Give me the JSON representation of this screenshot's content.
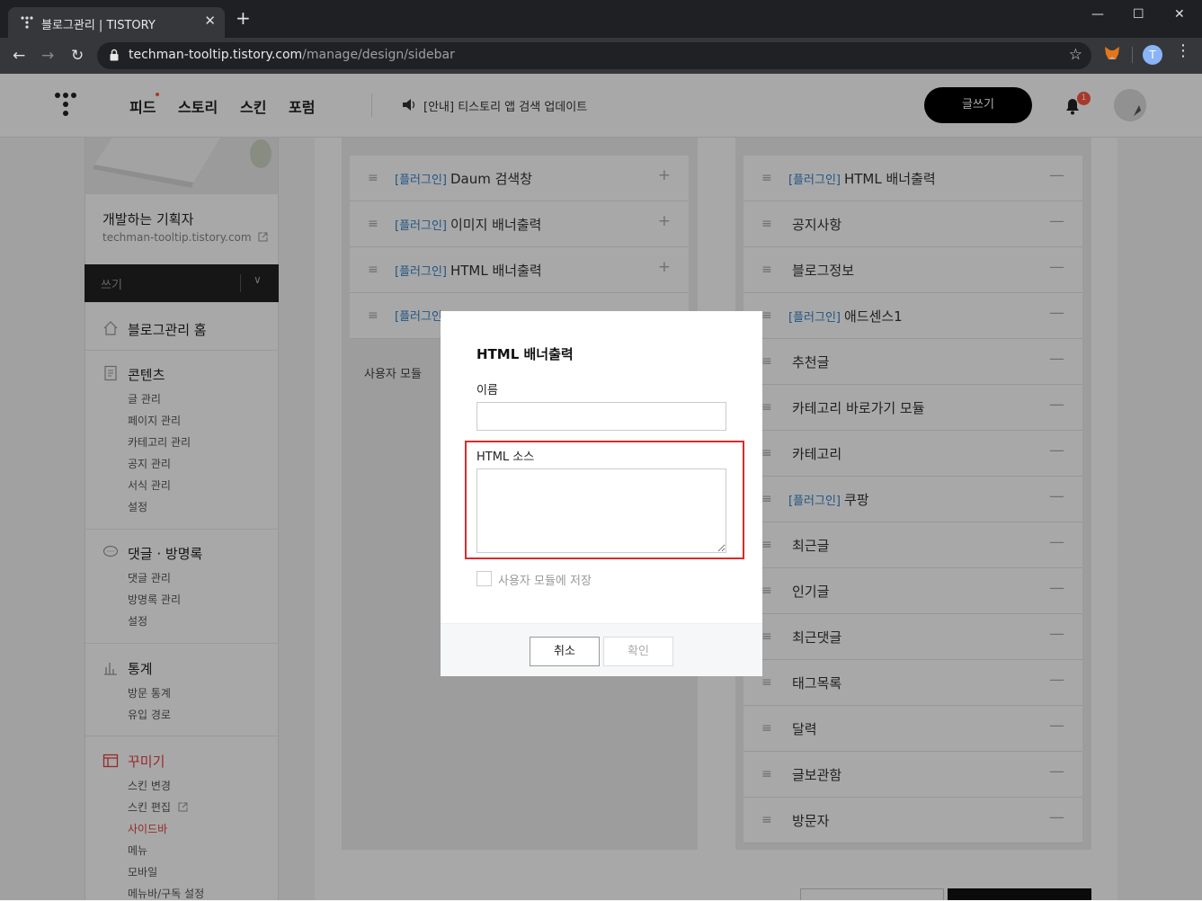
{
  "browser": {
    "tab_title": "블로그관리 | TISTORY",
    "tab_close": "✕",
    "new_tab": "+",
    "win_min": "—",
    "win_max": "☐",
    "win_close": "✕",
    "back": "←",
    "forward": "→",
    "reload": "↻",
    "url_host": "techman-tooltip.tistory.com",
    "url_path": "/manage/design/sidebar",
    "profile_initial": "T",
    "menu": "⋮"
  },
  "header": {
    "nav": [
      "피드",
      "스토리",
      "스킨",
      "포럼"
    ],
    "notice": "[안내] 티스토리 앱 검색 업데이트",
    "write_label": "글쓰기",
    "notif_count": "1"
  },
  "sidebar": {
    "blog_name": "개발하는 기획자",
    "blog_url": "techman-tooltip.tistory.com",
    "write_select": "쓰기",
    "home": "블로그관리 홈",
    "contents_title": "콘텐츠",
    "contents_items": [
      "글 관리",
      "페이지 관리",
      "카테고리 관리",
      "공지 관리",
      "서식 관리",
      "설정"
    ],
    "comments_title": "댓글 · 방명록",
    "comments_items": [
      "댓글 관리",
      "방명록 관리",
      "설정"
    ],
    "stats_title": "통계",
    "stats_items": [
      "방문 통계",
      "유입 경로"
    ],
    "design_title": "꾸미기",
    "design_items": [
      "스킨 변경",
      "스킨 편집",
      "사이드바",
      "메뉴",
      "모바일",
      "메뉴바/구독 설정"
    ]
  },
  "main": {
    "plugin_tag": "[플러그인]",
    "left_modules": [
      {
        "tag": "[플러그인]",
        "name": "Daum 검색창"
      },
      {
        "tag": "[플러그인]",
        "name": "이미지 배너출력"
      },
      {
        "tag": "[플러그인]",
        "name": "HTML 배너출력"
      },
      {
        "tag": "[플러그인]",
        "name": ""
      }
    ],
    "user_modules_label": "사용자 모듈",
    "right_modules": [
      {
        "tag": "[플러그인]",
        "name": "HTML 배너출력"
      },
      {
        "tag": "",
        "name": "공지사항"
      },
      {
        "tag": "",
        "name": "블로그정보"
      },
      {
        "tag": "[플러그인]",
        "name": "애드센스1"
      },
      {
        "tag": "",
        "name": "추천글"
      },
      {
        "tag": "",
        "name": "카테고리 바로가기 모듈"
      },
      {
        "tag": "",
        "name": "카테고리"
      },
      {
        "tag": "[플러그인]",
        "name": "쿠팡"
      },
      {
        "tag": "",
        "name": "최근글"
      },
      {
        "tag": "",
        "name": "인기글"
      },
      {
        "tag": "",
        "name": "최근댓글"
      },
      {
        "tag": "",
        "name": "태그목록"
      },
      {
        "tag": "",
        "name": "달력"
      },
      {
        "tag": "",
        "name": "글보관함"
      },
      {
        "tag": "",
        "name": "방문자"
      }
    ]
  },
  "modal": {
    "title": "HTML 배너출력",
    "name_label": "이름",
    "name_value": "",
    "source_label": "HTML 소스",
    "source_value": "",
    "save_label": "사용자 모듈에 저장",
    "cancel_label": "취소",
    "ok_label": "확인"
  },
  "colors": {
    "accent_red": "#e2403f",
    "plugin_blue": "#3481c9",
    "highlight_red": "#dd2a2a"
  }
}
